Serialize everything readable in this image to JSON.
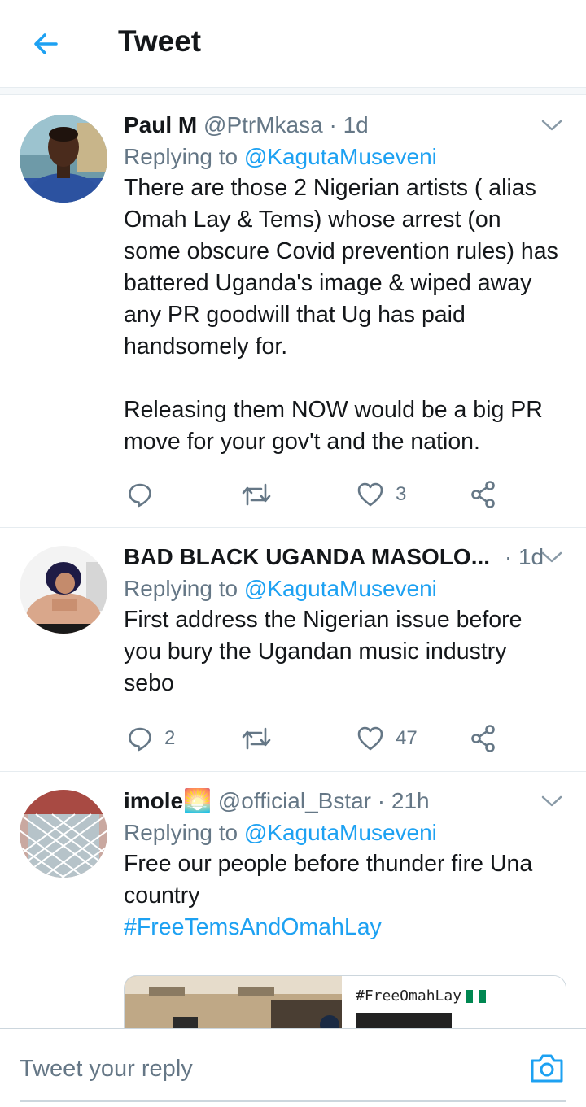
{
  "header": {
    "title": "Tweet"
  },
  "colors": {
    "accent": "#1da1f2",
    "secondary_text": "#657786",
    "primary_text": "#14171a",
    "divider": "#e6ecf0"
  },
  "tweets": [
    {
      "name": "Paul M",
      "handle": "@PtrMkasa",
      "dot": "·",
      "time": "1d",
      "replying_prefix": "Replying to",
      "replying_to": "@KagutaMuseveni",
      "body": "There are those 2 Nigerian artists ( alias Omah Lay & Tems) whose arrest (on some obscure Covid prevention rules) has battered Uganda's image & wiped away any PR goodwill that Ug has paid handsomely for.\n\nReleasing them NOW would be a big PR move for your gov't and the nation.",
      "replies": "",
      "retweets": "",
      "likes": "3"
    },
    {
      "name": "BAD BLACK UGANDA MASOLO...",
      "handle": "",
      "dot": "·",
      "time": "1d",
      "replying_prefix": "Replying to",
      "replying_to": "@KagutaMuseveni",
      "body": "First address the Nigerian issue before you bury the Ugandan music industry sebo",
      "replies": "2",
      "retweets": "",
      "likes": "47"
    },
    {
      "name": "imole",
      "name_emoji": "🌅",
      "handle": "@official_Bstar",
      "dot": "·",
      "time": "21h",
      "replying_prefix": "Replying to",
      "replying_to": "@KagutaMuseveni",
      "body": "Free our people before thunder fire Una country",
      "hashtag": "#FreeTemsAndOmahLay",
      "media_caption": "#FreeOmahLay"
    }
  ],
  "icons": {
    "back": "back-arrow-icon",
    "reply": "reply-icon",
    "retweet": "retweet-icon",
    "like": "like-icon",
    "share": "share-icon",
    "caret": "chevron-down-icon",
    "camera": "camera-icon"
  },
  "composer": {
    "placeholder": "Tweet your reply"
  }
}
